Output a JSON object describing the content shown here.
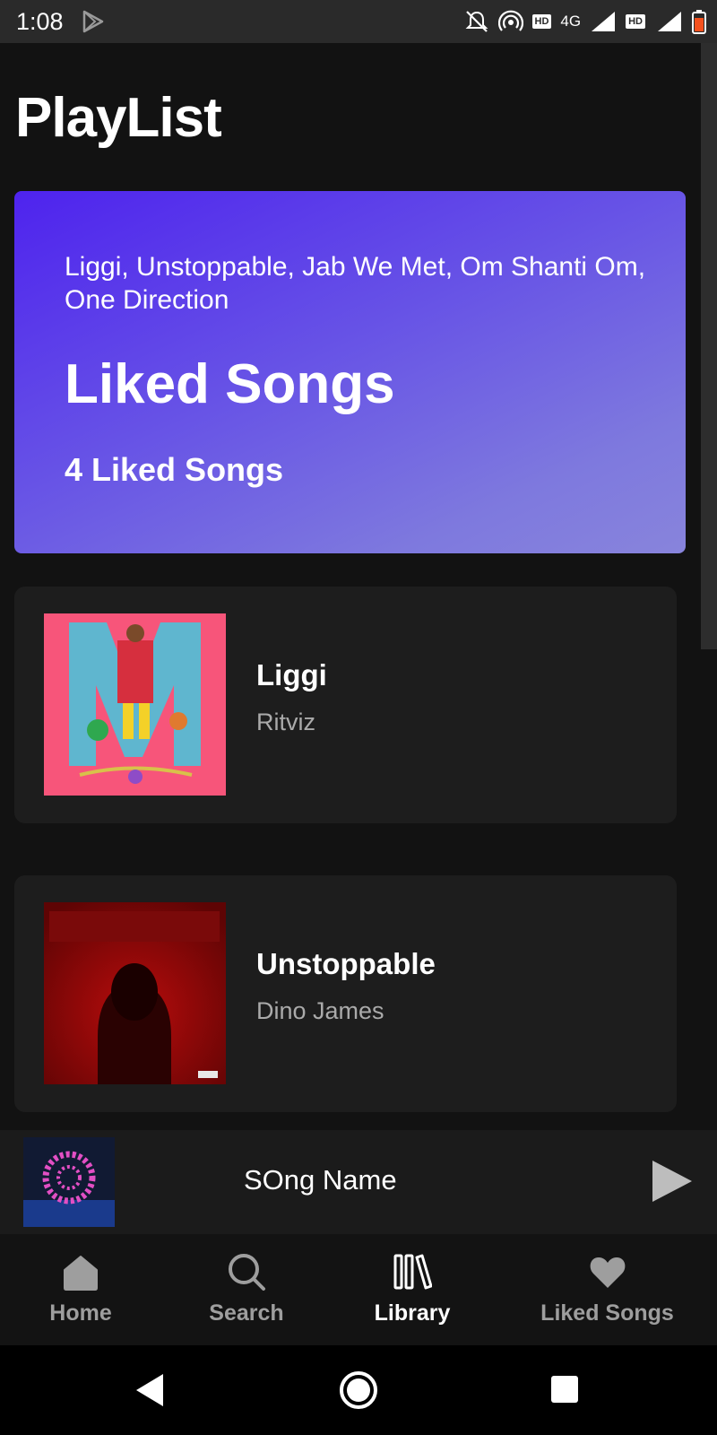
{
  "status_bar": {
    "time": "1:08",
    "network": "4G",
    "hd": "HD",
    "roaming": "R"
  },
  "page": {
    "title": "PlayList"
  },
  "liked_card": {
    "artists": "Liggi, Unstoppable, Jab We Met, Om Shanti Om, One Direction",
    "title": "Liked Songs",
    "count": "4 Liked Songs"
  },
  "songs": [
    {
      "title": "Liggi",
      "artist": "Ritviz"
    },
    {
      "title": "Unstoppable",
      "artist": "Dino James"
    }
  ],
  "mini_player": {
    "song_name": "SOng Name"
  },
  "bottom_nav": {
    "items": [
      {
        "label": "Home",
        "icon": "home-icon"
      },
      {
        "label": "Search",
        "icon": "search-icon"
      },
      {
        "label": "Library",
        "icon": "library-icon"
      },
      {
        "label": "Liked Songs",
        "icon": "heart-icon"
      }
    ],
    "active": "Library"
  },
  "colors": {
    "background": "#121212",
    "card_gradient_start": "#4e23ee",
    "card_gradient_end": "#8884dc",
    "song_card": "#1d1d1d",
    "inactive_label": "#9e9e9e"
  }
}
